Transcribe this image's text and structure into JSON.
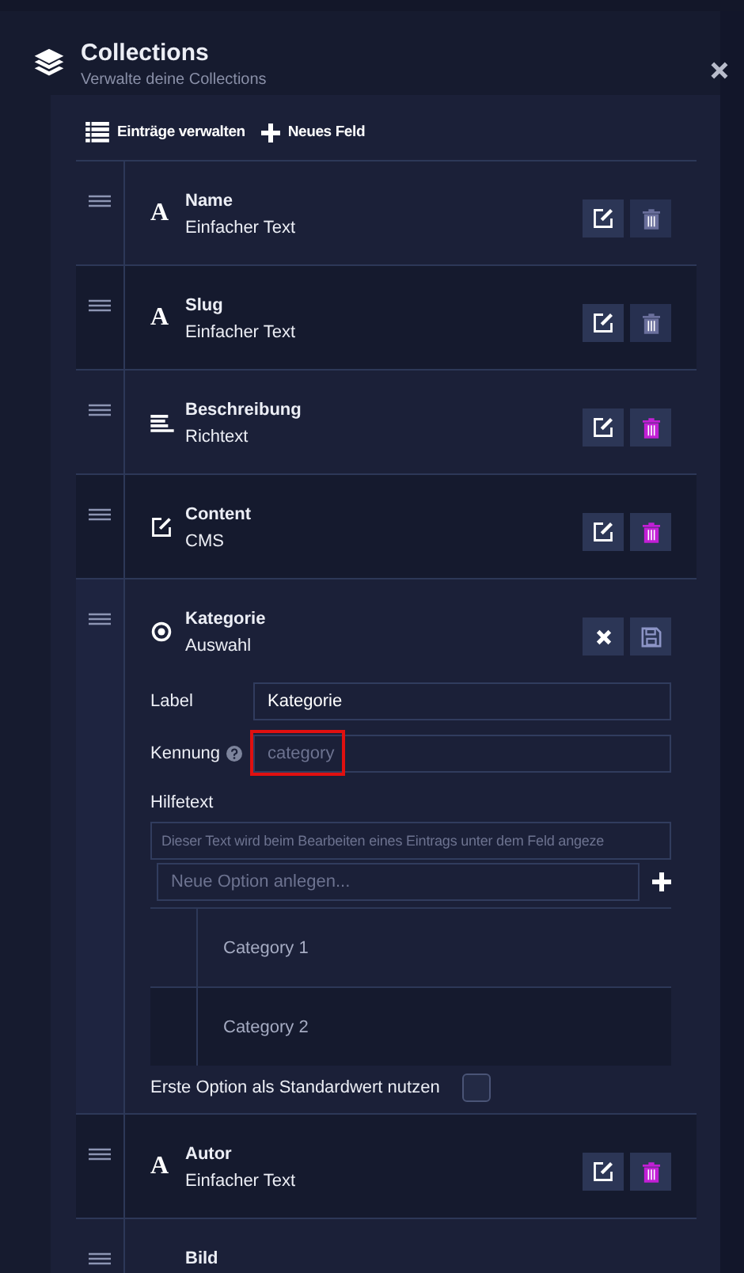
{
  "header": {
    "title": "Collections",
    "subtitle": "Verwalte deine Collections"
  },
  "toolbar": [
    {
      "kind": "list",
      "label": "Einträge verwalten"
    },
    {
      "kind": "add",
      "label": "Neues Feld"
    }
  ],
  "fields": [
    {
      "kind": "text",
      "icon": "A",
      "name": "Name",
      "type": "Einfacher Text",
      "expanded": false,
      "delete_disabled": true
    },
    {
      "kind": "text",
      "icon": "A",
      "name": "Slug",
      "type": "Einfacher Text",
      "expanded": false,
      "delete_disabled": true
    },
    {
      "kind": "richtext",
      "name": "Beschreibung",
      "type": "Richtext",
      "expanded": false,
      "delete_disabled": false
    },
    {
      "kind": "cms",
      "name": "Content",
      "type": "CMS",
      "expanded": false,
      "delete_disabled": false
    },
    {
      "kind": "select",
      "name": "Kategorie",
      "type": "Auswahl",
      "expanded": true,
      "editor": {
        "label_caption": "Label",
        "label_value": "Kategorie",
        "id_caption": "Kennung",
        "id_placeholder": "category",
        "id_highlighted": true,
        "help_caption": "Hilfetext",
        "help_placeholder": "Dieser Text wird beim Bearbeiten eines Eintrags unter dem Feld angeze",
        "option_placeholder": "Neue Option anlegen...",
        "options": [
          "Category 1",
          "Category 2"
        ],
        "default_caption": "Erste Option als Standardwert nutzen",
        "default_checked": false
      }
    },
    {
      "kind": "text",
      "icon": "A",
      "name": "Autor",
      "type": "Einfacher Text",
      "expanded": false,
      "delete_disabled": false
    },
    {
      "kind": "image",
      "name": "Bild"
    }
  ]
}
